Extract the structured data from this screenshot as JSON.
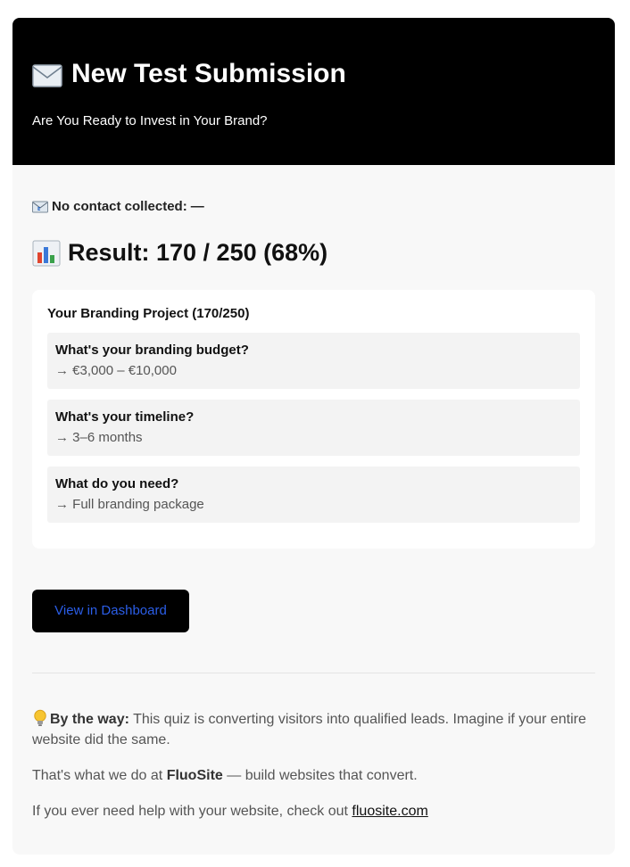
{
  "header": {
    "title": "New Test Submission",
    "subtitle": "Are You Ready to Invest in Your Brand?"
  },
  "contact": {
    "label": "No contact collected:",
    "value": "—"
  },
  "result": {
    "label": "Result: 170 / 250 (68%)"
  },
  "project": {
    "title": "Your Branding Project (170/250)",
    "items": [
      {
        "question": "What's your branding budget?",
        "answer": "→ €3,000 – €10,000"
      },
      {
        "question": "What's your timeline?",
        "answer": "→ 3–6 months"
      },
      {
        "question": "What do you need?",
        "answer": "→ Full branding package"
      }
    ]
  },
  "button": {
    "label": "View in Dashboard",
    "color": "#2b5ee8"
  },
  "footer": {
    "by_the_way_label": "By the way:",
    "by_the_way_text": " This quiz is converting visitors into qualified leads. Imagine if your entire website did the same.",
    "line2_prefix": "That's what we do at ",
    "brand": "FluoSite",
    "line2_suffix": " — build websites that convert.",
    "line3_prefix": "If you ever need help with your website, check out ",
    "link": "fluosite.com"
  },
  "icons": {
    "title": "envelope-icon",
    "contact": "email-icon",
    "result": "bar-chart-icon",
    "footer": "lightbulb-icon"
  }
}
